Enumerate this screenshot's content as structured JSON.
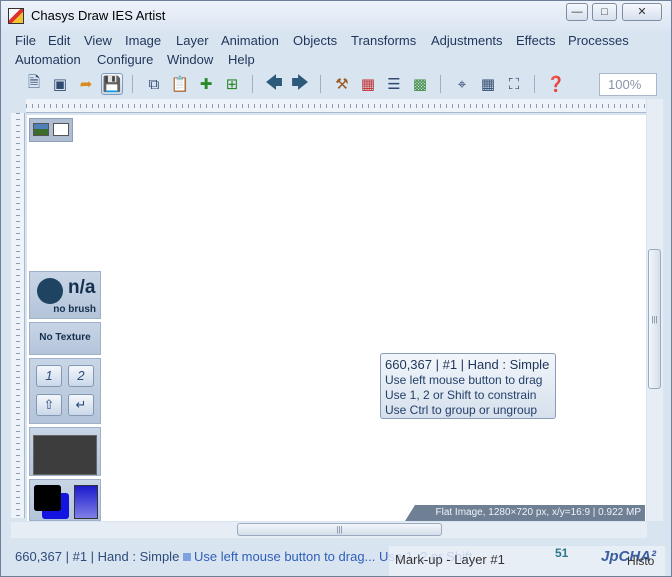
{
  "window": {
    "title": "Chasys Draw IES Artist",
    "buttons": {
      "minimize": "—",
      "maximize": "□",
      "close": "✕"
    }
  },
  "menu": [
    "File",
    "Edit",
    "View",
    "Image",
    "Layer",
    "Animation",
    "Objects",
    "Transforms",
    "Adjustments",
    "Effects",
    "Processes",
    "Automation",
    "Configure",
    "Window",
    "Help"
  ],
  "toolbar": {
    "icons": [
      "new-document-icon",
      "open-window-icon",
      "export-icon",
      "save-icon",
      "copy-icon",
      "paste-icon",
      "add-layer-icon",
      "paste-as-layer-icon",
      "back-arrow-icon",
      "forward-arrow-icon",
      "hammer-icon",
      "palette-grid-icon",
      "layers-stack-icon",
      "image-icon",
      "crop-icon",
      "grid-icon",
      "fullscreen-icon",
      "help-icon"
    ],
    "zoom": "100%"
  },
  "brush_panel": {
    "value": "n/a",
    "label": "no brush"
  },
  "texture_panel": {
    "label": "No Texture"
  },
  "key_buttons": [
    "1",
    "2",
    "⇧",
    "↵"
  ],
  "colors": {
    "foreground": "#000000",
    "background": "#1414e0",
    "accent": "#2e5fb8"
  },
  "tooltip": {
    "title": "660,367 | #1 | Hand : Simple",
    "lines": [
      "Use left mouse button to drag",
      "Use 1, 2 or Shift to constrain",
      "Use Ctrl to group or ungroup"
    ]
  },
  "image_info": "Flat Image, 1280×720 px, x/y=16:9 | 0.922 MP",
  "status": {
    "left": "660,367 | #1 | Hand : Simple",
    "right": "Use left mouse button to drag... Use 1, 2 or Shift..."
  },
  "taskbar": {
    "text": "Mark-up - Layer #1",
    "count": "51",
    "brand": "JpCHA²",
    "extra": "Histo"
  }
}
